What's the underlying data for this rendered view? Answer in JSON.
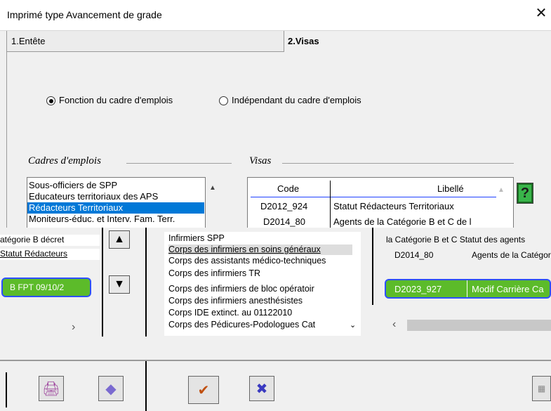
{
  "window": {
    "title": "Imprimé type Avancement de grade",
    "close_glyph": "✕"
  },
  "tabs": [
    {
      "label": "1.Entête",
      "active": false
    },
    {
      "label": "2.Visas",
      "active": true
    }
  ],
  "mode": {
    "option1": "Fonction du cadre d'emplois",
    "option2": "Indépendant du cadre d'emplois",
    "selected": "option1"
  },
  "cadres": {
    "title": "Cadres d'emplois",
    "items": [
      "Sous-officiers de SPP",
      "Educateurs territoriaux des APS",
      "Rédacteurs Territoriaux",
      "Moniteurs-éduc. et Interv. Fam. Terr."
    ],
    "selected_index": 2
  },
  "visas": {
    "title": "Visas",
    "col_code": "Code",
    "col_libelle": "Libellé",
    "rows": [
      {
        "code": "D2012_924",
        "libelle": "Statut Rédacteurs Territoriaux"
      },
      {
        "code": "D2014_80",
        "libelle": "Agents de la Catégorie B et C de l"
      }
    ],
    "help_glyph": "?"
  },
  "overlay": {
    "left_rows": [
      "atégorie B décret",
      "Statut Rédacteurs"
    ],
    "left_bar": "B FPT 09/10/2",
    "mid_top": [
      "Infirmiers SPP",
      "Corps des infirmiers en soins généraux",
      "Corps des assistants médico-techniques",
      "Corps des infirmiers TR"
    ],
    "mid_items": [
      "Corps des infirmiers de bloc opératoir",
      "Corps des infirmiers anesthésistes",
      "Corps IDE extinct. au 01122010",
      "Corps des Pédicures-Podologues Cat"
    ],
    "right_top": "la Catégorie B et C Statut des agents",
    "right_row": [
      "D2014_80",
      "Agents de la Catégorie"
    ],
    "right_bar_code": "D2023_927",
    "right_bar_label": "Modif Carrière Ca"
  },
  "icons": {
    "up_arrow": "▲",
    "down_arrow": "▼",
    "printer": "🖨",
    "diamond": "◆",
    "check": "✔",
    "cross": "✖",
    "scroll_right": "›",
    "scroll_left": "‹"
  },
  "colors": {
    "selection": "#0078d7",
    "green": "#5cbb2a",
    "accent_blue": "#2d4fff"
  }
}
